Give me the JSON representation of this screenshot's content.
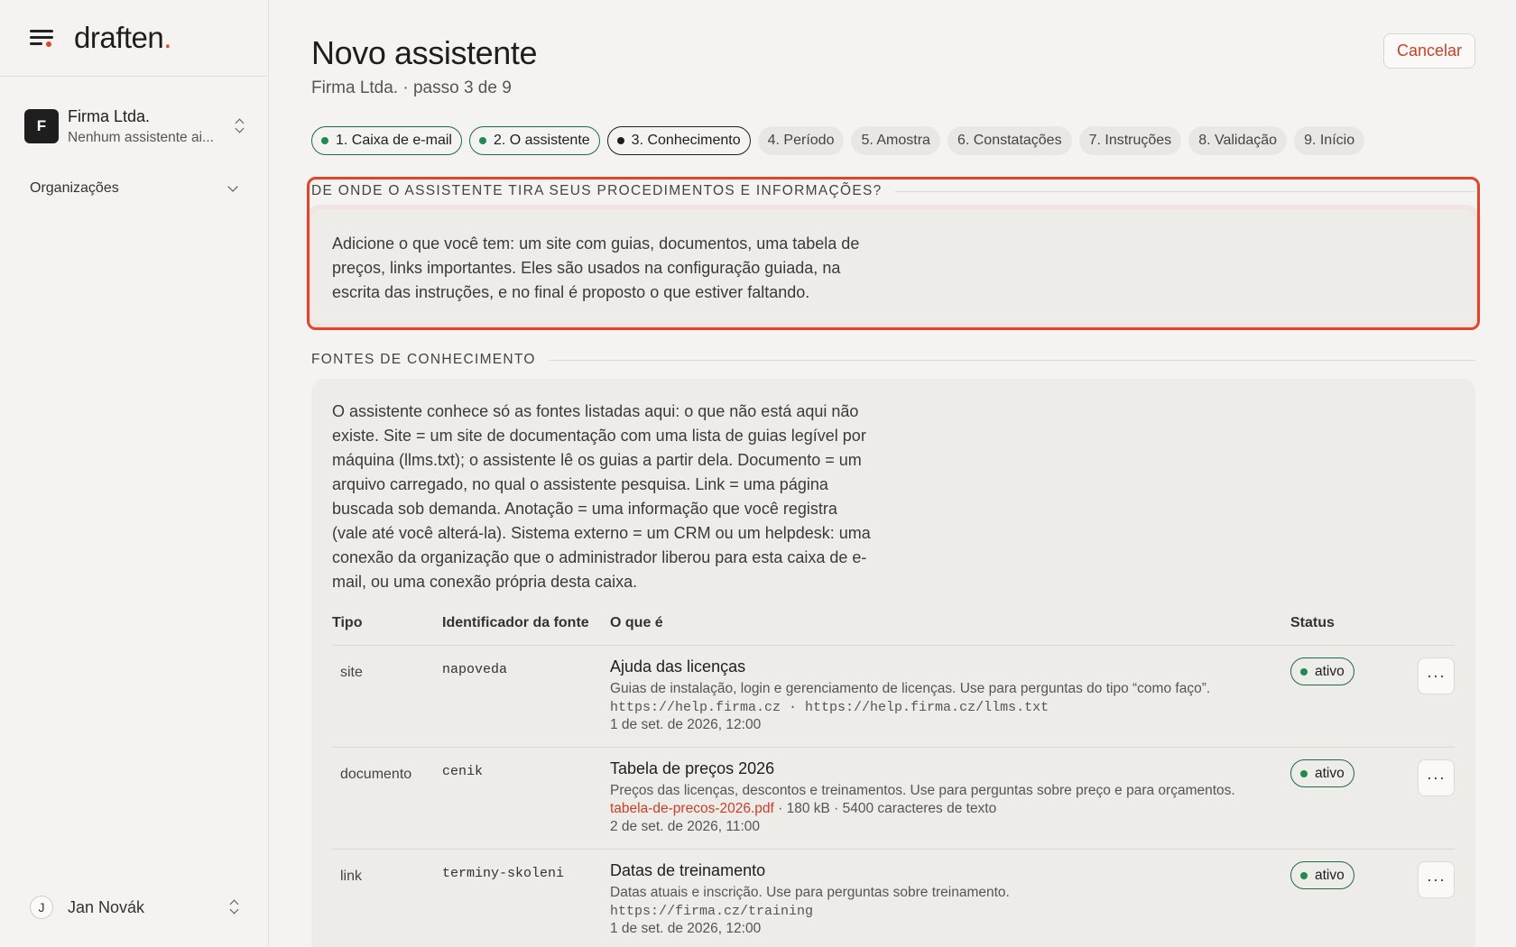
{
  "sidebar": {
    "logo": "draften",
    "logo_accent": ".",
    "org": {
      "initial": "F",
      "name": "Firma Ltda.",
      "subtitle": "Nenhum assistente ai..."
    },
    "section_label": "Organizações",
    "user": {
      "initial": "J",
      "name": "Jan Novák"
    }
  },
  "header": {
    "title": "Novo assistente",
    "subtitle": "Firma Ltda. · passo 3 de 9",
    "cancel_label": "Cancelar"
  },
  "steps": [
    {
      "label": "1. Caixa de e-mail",
      "state": "done"
    },
    {
      "label": "2. O assistente",
      "state": "done"
    },
    {
      "label": "3. Conhecimento",
      "state": "current"
    },
    {
      "label": "4. Período",
      "state": "todo"
    },
    {
      "label": "5. Amostra",
      "state": "todo"
    },
    {
      "label": "6. Constatações",
      "state": "todo"
    },
    {
      "label": "7. Instruções",
      "state": "todo"
    },
    {
      "label": "8. Validação",
      "state": "todo"
    },
    {
      "label": "9. Início",
      "state": "todo"
    }
  ],
  "intro": {
    "heading": "DE ONDE O ASSISTENTE TIRA SEUS PROCEDIMENTOS E INFORMAÇÕES?",
    "text": "Adicione o que você tem: um site com guias, documentos, uma tabela de preços, links importantes. Eles são usados na configuração guiada, na escrita das instruções, e no final é proposto o que estiver faltando."
  },
  "sources": {
    "heading": "FONTES DE CONHECIMENTO",
    "text": "O assistente conhece só as fontes listadas aqui: o que não está aqui não existe. Site = um site de documentação com uma lista de guias legível por máquina (llms.txt); o assistente lê os guias a partir dela. Documento = um arquivo carregado, no qual o assistente pesquisa. Link = uma página buscada sob demanda. Anotação = uma informação que você registra (vale até você alterá-la). Sistema externo = um CRM ou um helpdesk: uma conexão da organização que o administrador liberou para esta caixa de e-mail, ou uma conexão própria desta caixa.",
    "columns": {
      "type": "Tipo",
      "id": "Identificador da fonte",
      "what": "O que é",
      "status": "Status"
    },
    "rows": [
      {
        "type": "site",
        "id": "napoveda",
        "title": "Ajuda das licenças",
        "desc": "Guias de instalação, login e gerenciamento de licenças. Use para perguntas do tipo “como faço”.",
        "meta_mono": "https://help.firma.cz · https://help.firma.cz/llms.txt",
        "date": "1 de set. de 2026, 12:00",
        "status": "ativo",
        "more": "···"
      },
      {
        "type": "documento",
        "id": "cenik",
        "title": "Tabela de preços 2026",
        "desc": "Preços das licenças, descontos e treinamentos. Use para perguntas sobre preço e para orçamentos.",
        "file": "tabela-de-precos-2026.pdf",
        "file_meta": " · 180 kB · 5400 caracteres de texto",
        "date": "2 de set. de 2026, 11:00",
        "status": "ativo",
        "more": "···"
      },
      {
        "type": "link",
        "id": "terminy-skoleni",
        "title": "Datas de treinamento",
        "desc": "Datas atuais e inscrição. Use para perguntas sobre treinamento.",
        "meta_mono": "https://firma.cz/training",
        "date": "1 de set. de 2026, 12:00",
        "status": "ativo",
        "more": "···"
      }
    ]
  },
  "colors": {
    "accent": "#e0452b",
    "success": "#1f8a54",
    "background": "#f4f3f1"
  }
}
